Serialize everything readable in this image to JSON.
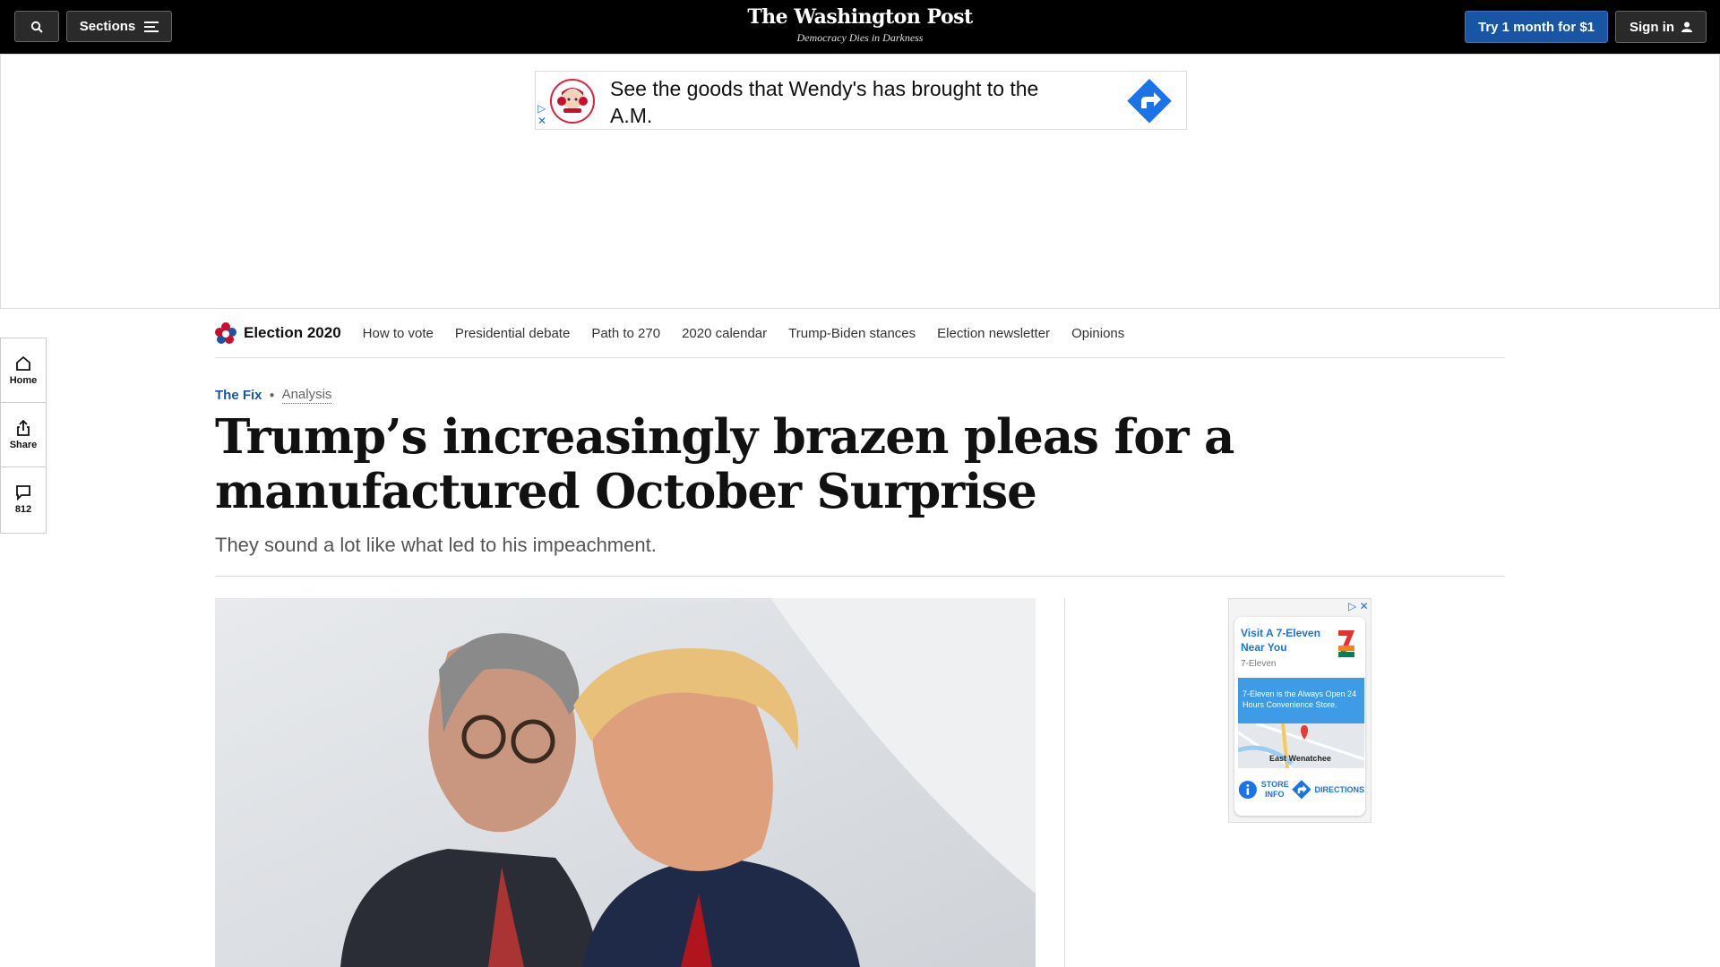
{
  "header": {
    "sections_label": "Sections",
    "masthead": "The Washington Post",
    "tagline": "Democracy Dies in Darkness",
    "try_label": "Try 1 month for $1",
    "signin_label": "Sign in"
  },
  "top_ad": {
    "text": "See the goods that Wendy's has brought to the A.M."
  },
  "rail": {
    "home": "Home",
    "share": "Share",
    "comments": "812"
  },
  "election_nav": {
    "title": "Election 2020",
    "links": [
      "How to vote",
      "Presidential debate",
      "Path to 270",
      "2020 calendar",
      "Trump-Biden stances",
      "Election newsletter",
      "Opinions"
    ]
  },
  "article": {
    "section": "The Fix",
    "label": "Analysis",
    "headline": "Trump’s increasingly brazen pleas for a manufactured October Surprise",
    "dek": "They sound a lot like what led to his impeachment."
  },
  "side_ad": {
    "headline": "Visit A 7-Eleven Near You",
    "brand": "7-Eleven",
    "banner": "7-Eleven is the Always Open 24 Hours Convenience Store.",
    "city": "East Wenatchee",
    "store_info": "STORE INFO",
    "directions": "DIRECTIONS"
  },
  "colors": {
    "header_bg": "#000000",
    "subscribe_blue": "#1955a5",
    "section_blue": "#1955a5"
  }
}
